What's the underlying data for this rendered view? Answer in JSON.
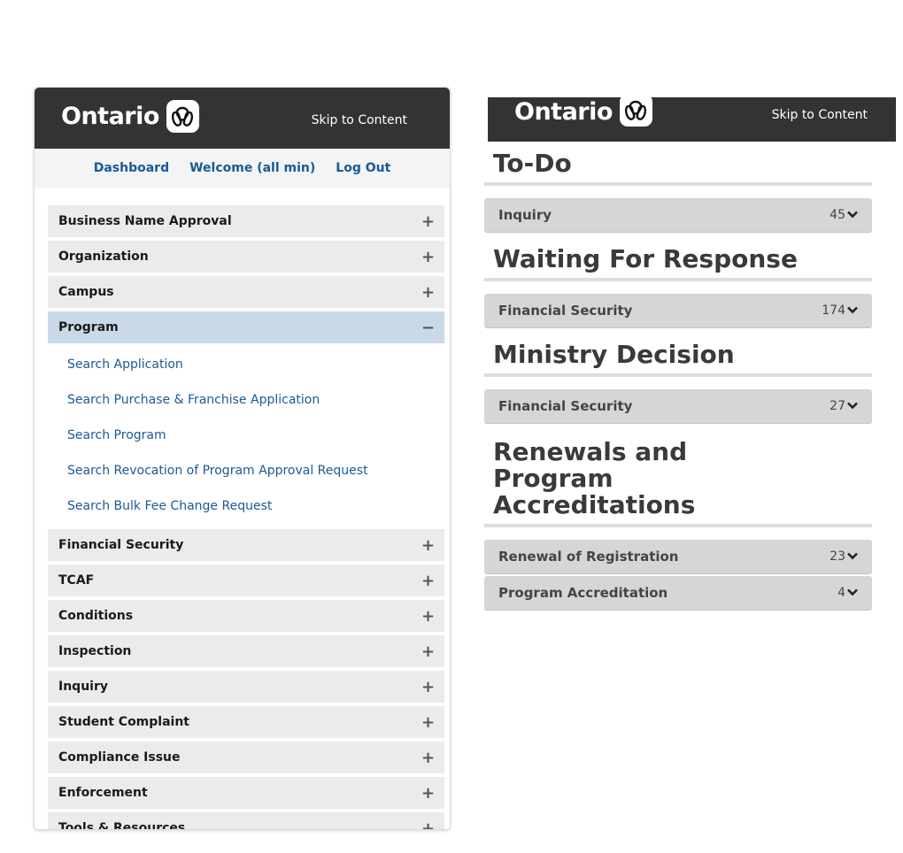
{
  "brand": {
    "wordmark": "Ontario",
    "logo_icon": "trillium-icon"
  },
  "left": {
    "skip_link": "Skip to Content",
    "utility_links": [
      "Dashboard",
      "Welcome (all min)",
      "Log Out"
    ],
    "menu": [
      {
        "label": "Business Name Approval",
        "toggle": "+"
      },
      {
        "label": "Organization",
        "toggle": "+"
      },
      {
        "label": "Campus",
        "toggle": "+"
      },
      {
        "label": "Program",
        "toggle": "−"
      },
      {
        "label": "Financial Security",
        "toggle": "+"
      },
      {
        "label": "TCAF",
        "toggle": "+"
      },
      {
        "label": "Conditions",
        "toggle": "+"
      },
      {
        "label": "Inspection",
        "toggle": "+"
      },
      {
        "label": "Inquiry",
        "toggle": "+"
      },
      {
        "label": "Student Complaint",
        "toggle": "+"
      },
      {
        "label": "Compliance Issue",
        "toggle": "+"
      },
      {
        "label": "Enforcement",
        "toggle": "+"
      },
      {
        "label": "Tools & Resources",
        "toggle": "+"
      }
    ],
    "program_submenu": [
      "Search Application",
      "Search Purchase & Franchise Application",
      "Search Program",
      "Search Revocation of Program Approval Request",
      "Search Bulk Fee Change Request"
    ]
  },
  "right": {
    "skip_link": "Skip to Content",
    "sections": [
      {
        "title": "To-Do",
        "rows": [
          {
            "label": "Inquiry",
            "count": "45"
          }
        ]
      },
      {
        "title": "Waiting For Response",
        "rows": [
          {
            "label": "Financial Security",
            "count": "174"
          }
        ]
      },
      {
        "title": "Ministry Decision",
        "rows": [
          {
            "label": "Financial Security",
            "count": "27"
          }
        ]
      },
      {
        "title": "Renewals and Program Accreditations",
        "rows": [
          {
            "label": "Renewal of Registration",
            "count": "23"
          },
          {
            "label": "Program Accreditation",
            "count": "4"
          }
        ]
      }
    ]
  },
  "colors": {
    "header_bg": "#333333",
    "link_blue": "#1a5a96",
    "expanded_bg": "#c9d9e8"
  }
}
